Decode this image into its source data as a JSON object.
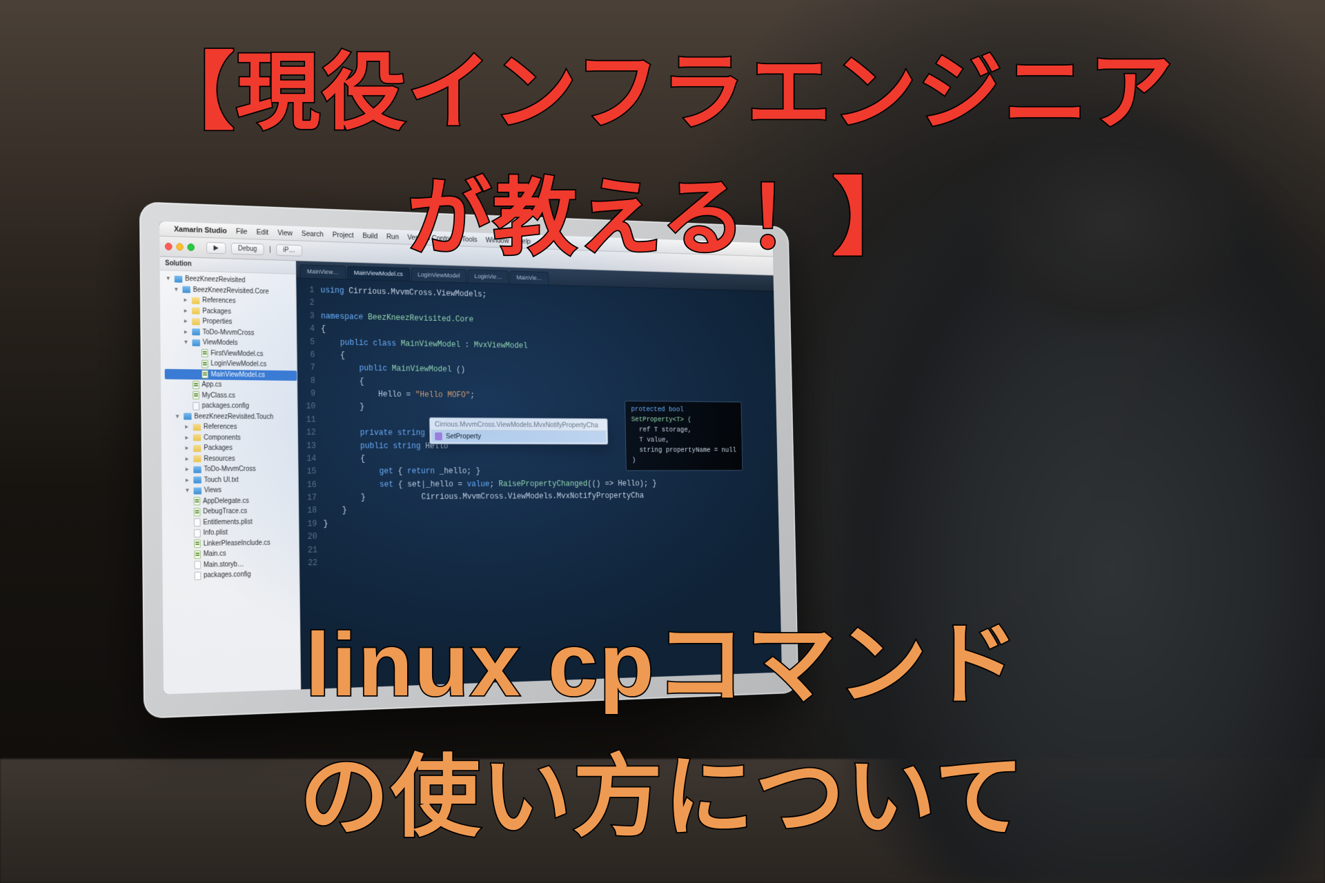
{
  "overlay": {
    "red_line1": "【現役インフラエンジニア",
    "red_line2": "が教える！】",
    "orange_line1": "linux cpコマンド",
    "orange_line2": "の使い方について"
  },
  "menubar": {
    "apple": "",
    "app": "Xamarin Studio",
    "items": [
      "File",
      "Edit",
      "View",
      "Search",
      "Project",
      "Build",
      "Run",
      "Version Control",
      "Tools",
      "Window",
      "Help"
    ]
  },
  "toolbar": {
    "nav_back": "◀",
    "nav_fwd": "▶",
    "run": "▶",
    "config": "Debug",
    "sep": "|",
    "target": "iP…"
  },
  "tabs": {
    "items": [
      "MainView…",
      "MainViewModel.cs",
      "LoginViewModel",
      "LoginVie…",
      "MainVie…"
    ],
    "active_index": 1
  },
  "sidebar": {
    "header": "Solution",
    "tree": [
      {
        "d": 0,
        "icon": "fold",
        "label": "BeezKneezRevisited",
        "open": true
      },
      {
        "d": 1,
        "icon": "fold",
        "label": "BeezKneezRevisited.Core",
        "open": true
      },
      {
        "d": 2,
        "icon": "fold-y",
        "label": "References"
      },
      {
        "d": 2,
        "icon": "fold-y",
        "label": "Packages"
      },
      {
        "d": 2,
        "icon": "fold-y",
        "label": "Properties"
      },
      {
        "d": 2,
        "icon": "fold",
        "label": "ToDo-MvvmCross"
      },
      {
        "d": 2,
        "icon": "fold",
        "label": "ViewModels",
        "open": true
      },
      {
        "d": 3,
        "icon": "cs",
        "label": "FirstViewModel.cs"
      },
      {
        "d": 3,
        "icon": "cs",
        "label": "LoginViewModel.cs"
      },
      {
        "d": 3,
        "icon": "cs",
        "label": "MainViewModel.cs",
        "sel": true
      },
      {
        "d": 2,
        "icon": "cs",
        "label": "App.cs"
      },
      {
        "d": 2,
        "icon": "cs",
        "label": "MyClass.cs"
      },
      {
        "d": 2,
        "icon": "txt",
        "label": "packages.config"
      },
      {
        "d": 1,
        "icon": "fold",
        "label": "BeezKneezRevisited.Touch",
        "open": true
      },
      {
        "d": 2,
        "icon": "fold-y",
        "label": "References"
      },
      {
        "d": 2,
        "icon": "fold-y",
        "label": "Components"
      },
      {
        "d": 2,
        "icon": "fold-y",
        "label": "Packages"
      },
      {
        "d": 2,
        "icon": "fold-y",
        "label": "Resources"
      },
      {
        "d": 2,
        "icon": "fold",
        "label": "ToDo-MvvmCross"
      },
      {
        "d": 2,
        "icon": "fold",
        "label": "Touch UI.txt"
      },
      {
        "d": 2,
        "icon": "fold",
        "label": "Views",
        "open": true
      },
      {
        "d": 2,
        "icon": "cs",
        "label": "AppDelegate.cs"
      },
      {
        "d": 2,
        "icon": "cs",
        "label": "DebugTrace.cs"
      },
      {
        "d": 2,
        "icon": "txt",
        "label": "Entitlements.plist"
      },
      {
        "d": 2,
        "icon": "txt",
        "label": "Info.plist"
      },
      {
        "d": 2,
        "icon": "cs",
        "label": "LinkerPleaseInclude.cs"
      },
      {
        "d": 2,
        "icon": "cs",
        "label": "Main.cs"
      },
      {
        "d": 2,
        "icon": "txt",
        "label": "Main.storyb…"
      },
      {
        "d": 2,
        "icon": "txt",
        "label": "packages.config"
      }
    ]
  },
  "code": {
    "lines": [
      {
        "n": 1,
        "html": "<span class='kw'>using</span> Cirrious.MvvmCross.ViewModels;"
      },
      {
        "n": 2,
        "html": ""
      },
      {
        "n": 3,
        "html": "<span class='kw'>namespace</span> <span class='cls'>BeezKneezRevisited.Core</span>"
      },
      {
        "n": 4,
        "html": "{"
      },
      {
        "n": 5,
        "html": "    <span class='kw'>public class</span> <span class='cls'>MainViewModel</span> : <span class='cls'>MvxViewModel</span>"
      },
      {
        "n": 6,
        "html": "    {"
      },
      {
        "n": 7,
        "html": "        <span class='kw'>public</span> <span class='cls'>MainViewModel</span> ()"
      },
      {
        "n": 8,
        "html": "        {"
      },
      {
        "n": 9,
        "html": "            Hello = <span class='str'>\"Hello MOFO\"</span>;"
      },
      {
        "n": 10,
        "html": "        }"
      },
      {
        "n": 11,
        "html": ""
      },
      {
        "n": 12,
        "html": "        <span class='kw'>private string</span> _hello = <span class='str'>\"Hello MvvmCross\"</span>;"
      },
      {
        "n": 13,
        "html": "        <span class='kw'>public string</span> Hello"
      },
      {
        "n": 14,
        "html": "        {"
      },
      {
        "n": 15,
        "html": "            <span class='kw'>get</span> { <span class='kw'>return</span> _hello; }"
      },
      {
        "n": 16,
        "html": "            <span class='kw'>set</span> { set<span class='pn'>|</span>_hello = <span class='kw'>value</span>; <span class='cls'>RaisePropertyChanged</span>(() =&gt; Hello); }"
      },
      {
        "n": 17,
        "html": "        }            Cirrious.MvvmCross.ViewModels.MvxNotifyPropertyCha"
      },
      {
        "n": 18,
        "html": "    }"
      },
      {
        "n": 19,
        "html": "}"
      },
      {
        "n": 20,
        "html": ""
      },
      {
        "n": 21,
        "html": ""
      },
      {
        "n": 22,
        "html": ""
      }
    ]
  },
  "intellisense": {
    "header": "Cirrious.MvvmCross.ViewModels.MvxNotifyPropertyCha",
    "item": "SetProperty"
  },
  "tooltip": {
    "l1": "protected bool",
    "l2": "SetProperty<T> (",
    "l3": "  ref T storage,",
    "l4": "  T value,",
    "l5": "  string propertyName = null",
    "l6": ")"
  }
}
